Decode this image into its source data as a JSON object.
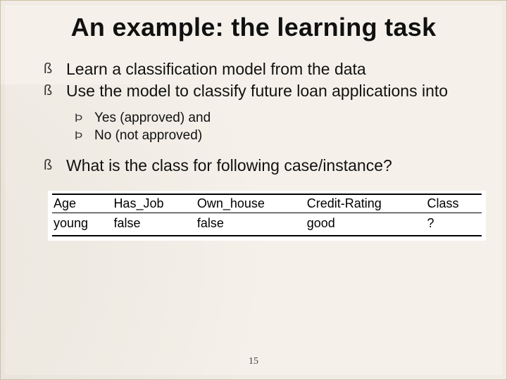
{
  "title": "An example: the learning task",
  "bullets": {
    "b1": "Learn a classification model from the data",
    "b2": "Use the model to classify future loan applications into",
    "sub1": "Yes (approved) and",
    "sub2": "No (not approved)",
    "b3": "What is the class for following case/instance?"
  },
  "table": {
    "headers": {
      "age": "Age",
      "has_job": "Has_Job",
      "own_house": "Own_house",
      "credit_rating": "Credit-Rating",
      "class": "Class"
    },
    "row": {
      "age": "young",
      "has_job": "false",
      "own_house": "false",
      "credit_rating": "good",
      "class": "?"
    }
  },
  "page_number": "15"
}
